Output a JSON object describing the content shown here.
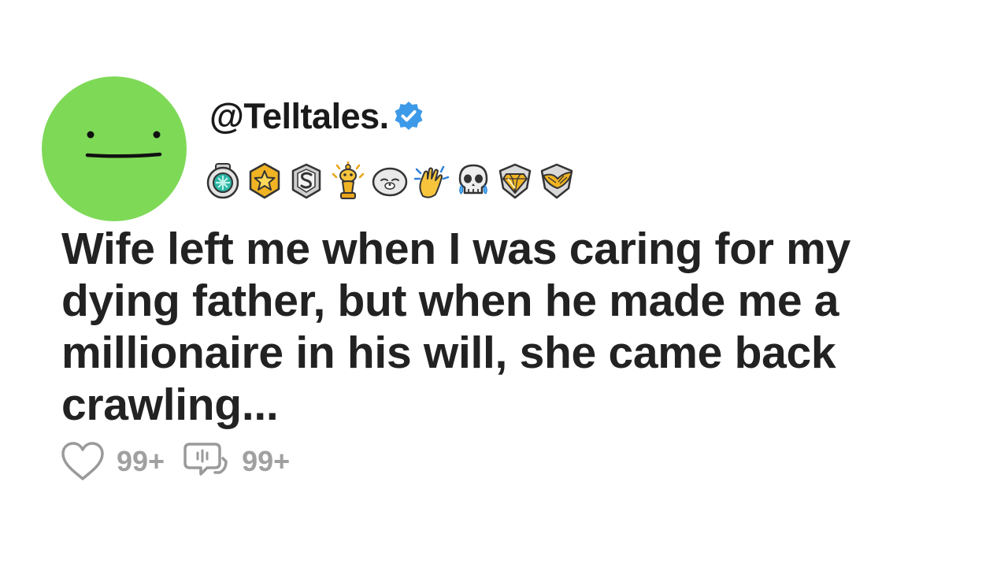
{
  "post": {
    "username": "@Telltales.",
    "verified": true,
    "title": "Wife left me when I was caring for my dying father, but when he made me a millionaire in his will, she came back crawling...",
    "like_count": "99+",
    "comment_count": "99+"
  },
  "avatar": {
    "color": "#7ed957",
    "face": "neutral-face-icon"
  },
  "verified_badge": {
    "color": "#3d9ae8",
    "icon": "verified-check-icon"
  },
  "awards": [
    "helpful-award-icon",
    "gold-star-award-icon",
    "silver-s-award-icon",
    "gold-snoo-award-icon",
    "seal-award-icon",
    "clapping-hands-award-icon",
    "crying-skull-award-icon",
    "diamond-heart-award-icon",
    "golden-wings-award-icon"
  ],
  "colors": {
    "title": "#222222",
    "meta": "#a0a0a0"
  }
}
